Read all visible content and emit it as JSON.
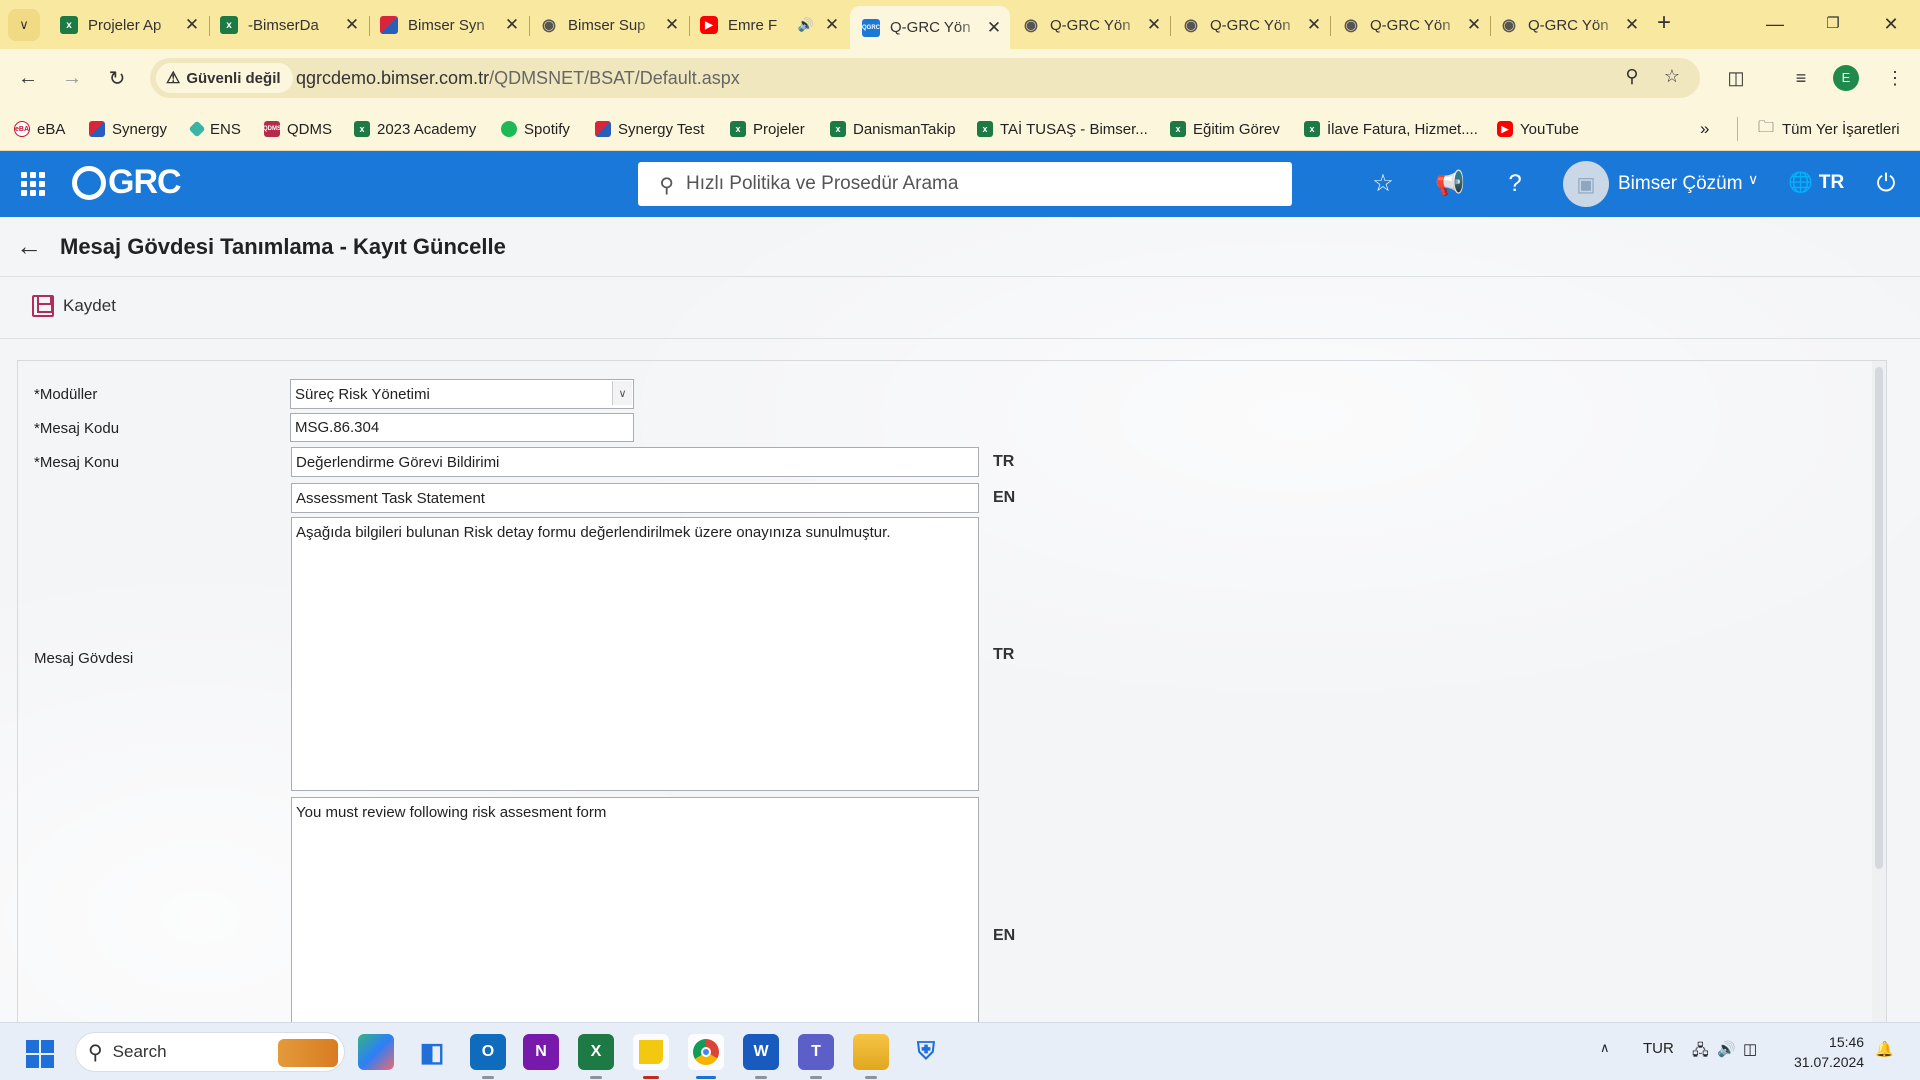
{
  "browser": {
    "tabs": [
      {
        "title": "Projeler Ap",
        "icon": "excel-icon"
      },
      {
        "title": "-BimserDa",
        "icon": "excel-icon"
      },
      {
        "title": "Bimser Syn",
        "icon": "synergy-icon"
      },
      {
        "title": "Bimser Sup",
        "icon": "globe-icon"
      },
      {
        "title": "Emre F",
        "icon": "youtube-icon"
      },
      {
        "title": "Q-GRC Yön",
        "icon": "qgrc-icon"
      },
      {
        "title": "Q-GRC Yön",
        "icon": "globe-icon"
      },
      {
        "title": "Q-GRC Yön",
        "icon": "globe-icon"
      },
      {
        "title": "Q-GRC Yön",
        "icon": "globe-icon"
      },
      {
        "title": "Q-GRC Yön",
        "icon": "globe-icon"
      }
    ],
    "security_label": "Güvenli değil",
    "url_host": "qgrcdemo.bimser.com.tr",
    "url_path": "/QDMSNET/BSAT/Default.aspx",
    "profile_initial": "E",
    "bookmarks": [
      {
        "label": "eBA",
        "icon": "eba-icon"
      },
      {
        "label": "Synergy",
        "icon": "synergy-icon"
      },
      {
        "label": "ENS",
        "icon": "ens-icon"
      },
      {
        "label": "QDMS",
        "icon": "qdms-icon"
      },
      {
        "label": "2023 Academy",
        "icon": "excel-icon"
      },
      {
        "label": "Spotify",
        "icon": "spotify-icon"
      },
      {
        "label": "Synergy Test",
        "icon": "synergy-icon"
      },
      {
        "label": "Projeler",
        "icon": "excel-icon"
      },
      {
        "label": "DanismanTakip",
        "icon": "excel-icon"
      },
      {
        "label": "TAİ TUSAŞ - Bimser...",
        "icon": "excel-icon"
      },
      {
        "label": "Eğitim Görev",
        "icon": "excel-icon"
      },
      {
        "label": "İlave Fatura, Hizmet....",
        "icon": "excel-icon"
      },
      {
        "label": "YouTube",
        "icon": "youtube-icon"
      }
    ],
    "all_bookmarks": "Tüm Yer İşaretleri"
  },
  "app": {
    "logo": "GRC",
    "search_placeholder": "Hızlı Politika ve Prosedür Arama",
    "user_name": "Bimser Çözüm",
    "language": "TR",
    "brand_color": "#1a78d8"
  },
  "page": {
    "title": "Mesaj Gövdesi Tanımlama - Kayıt Güncelle",
    "save_label": "Kaydet"
  },
  "form": {
    "modules_label": "*Modüller",
    "modules_value": "Süreç Risk Yönetimi",
    "code_label": "*Mesaj Kodu",
    "code_value": "MSG.86.304",
    "subject_label": "*Mesaj Konu",
    "subject_tr": "Değerlendirme Görevi Bildirimi",
    "subject_en": "Assessment Task Statement",
    "body_label": "Mesaj Gövdesi",
    "body_tr": "Aşağıda bilgileri bulunan Risk detay formu değerlendirilmek üzere onayınıza sunulmuştur.",
    "body_en": "You must review following risk assesment form",
    "lang_tr": "TR",
    "lang_en": "EN"
  },
  "taskbar": {
    "search_label": "Search",
    "keyboard_lang": "TUR",
    "time": "15:46",
    "date": "31.07.2024"
  }
}
